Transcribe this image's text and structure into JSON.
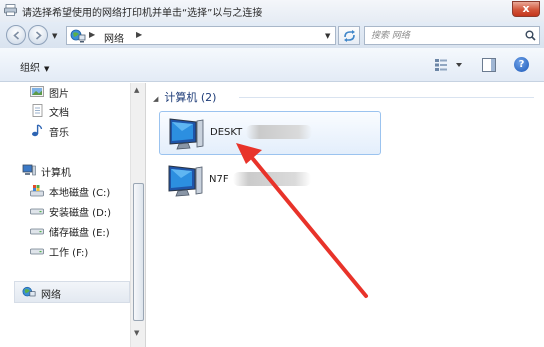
{
  "window": {
    "title": "请选择希望使用的网络打印机并单击“选择”以与之连接",
    "close_glyph": "x"
  },
  "address_bar": {
    "crumbs": [
      "网络"
    ],
    "search_placeholder": "搜索 网络"
  },
  "toolbar": {
    "organize_label": "组织",
    "help_glyph": "?"
  },
  "nav_pane": {
    "items": [
      {
        "label": "图片",
        "icon": "pictures-icon"
      },
      {
        "label": "文档",
        "icon": "documents-icon"
      },
      {
        "label": "音乐",
        "icon": "music-icon"
      }
    ],
    "computer": {
      "label": "计算机",
      "icon": "computer-icon",
      "drives": [
        {
          "label": "本地磁盘 (C:)",
          "icon": "system-drive-icon"
        },
        {
          "label": "安装磁盘 (D:)",
          "icon": "drive-icon"
        },
        {
          "label": "储存磁盘 (E:)",
          "icon": "drive-icon"
        },
        {
          "label": "工作 (F:)",
          "icon": "drive-icon"
        }
      ]
    },
    "network": {
      "label": "网络",
      "icon": "network-icon",
      "selected": true
    }
  },
  "content": {
    "group_header": "计算机 (2)",
    "computers": [
      {
        "name": "DESKT",
        "selected": true,
        "icon": "monitor-icon"
      },
      {
        "name": "N7F",
        "selected": false,
        "icon": "monitor-icon"
      }
    ]
  },
  "colors": {
    "accent": "#1e3c78",
    "annotation_arrow": "#e8332a",
    "selection_border": "#9bc3ef",
    "close_button": "#c4361d"
  }
}
